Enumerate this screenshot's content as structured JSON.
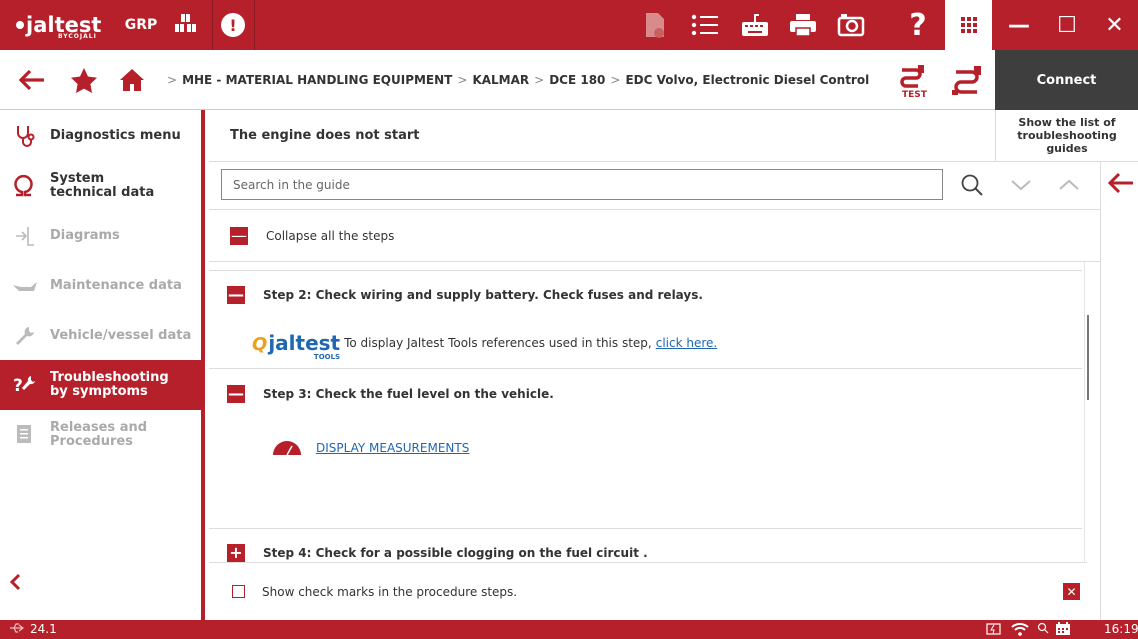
{
  "topbar": {
    "logo_text": "jaltest",
    "logo_sub": "BYCOJALI",
    "grp_label": "GRP",
    "alert_glyph": "!",
    "help_glyph": "?",
    "window_controls": {
      "minimize": "—",
      "maximize": "☐",
      "close": "✕"
    },
    "brand_color": "#b5202a"
  },
  "breadcrumb": {
    "items": [
      "MHE - MATERIAL HANDLING EQUIPMENT",
      "KALMAR",
      "DCE 180",
      "EDC Volvo, Electronic Diesel Control"
    ],
    "separator": ">",
    "test_label": "TEST",
    "connect_label": "Connect"
  },
  "sidebar": {
    "items": [
      {
        "label": "Diagnostics menu",
        "icon": "stethoscope-icon",
        "state": "normal"
      },
      {
        "label": "System technical data",
        "icon": "omega-icon",
        "state": "normal"
      },
      {
        "label": "Diagrams",
        "icon": "diagram-icon",
        "state": "disabled"
      },
      {
        "label": "Maintenance data",
        "icon": "oil-can-icon",
        "state": "disabled"
      },
      {
        "label": "Vehicle/vessel data",
        "icon": "wrench-icon",
        "state": "disabled"
      },
      {
        "label": "Troubleshooting by symptoms",
        "icon": "troubleshoot-icon",
        "state": "active"
      },
      {
        "label": "Releases and Procedures",
        "icon": "document-icon",
        "state": "disabled"
      }
    ]
  },
  "main": {
    "title": "The engine does not start",
    "show_list_label": "Show the list of troubleshooting guides",
    "search_placeholder": "Search in the guide",
    "collapse_label": "Collapse all the steps",
    "collapse_glyph": "—",
    "steps": [
      {
        "label": "Step 2: Check wiring and supply battery. Check fuses and relays.",
        "glyph": "—"
      },
      {
        "label": "Step 3: Check the fuel level on the vehicle.",
        "glyph": "—"
      },
      {
        "label": "Step 4: Check for a possible clogging on the fuel circuit .",
        "glyph": "+"
      }
    ],
    "tools_ref": {
      "logo_text": "jaltest",
      "logo_sub": "TOOLS",
      "text": "To display Jaltest Tools references used in this step,",
      "link": "click here."
    },
    "measurements_link": "DISPLAY MEASUREMENTS",
    "checkmarks_label": "Show check marks in the procedure steps.",
    "close_glyph": "✕"
  },
  "statusbar": {
    "version": "24.1",
    "time": "16:19"
  }
}
